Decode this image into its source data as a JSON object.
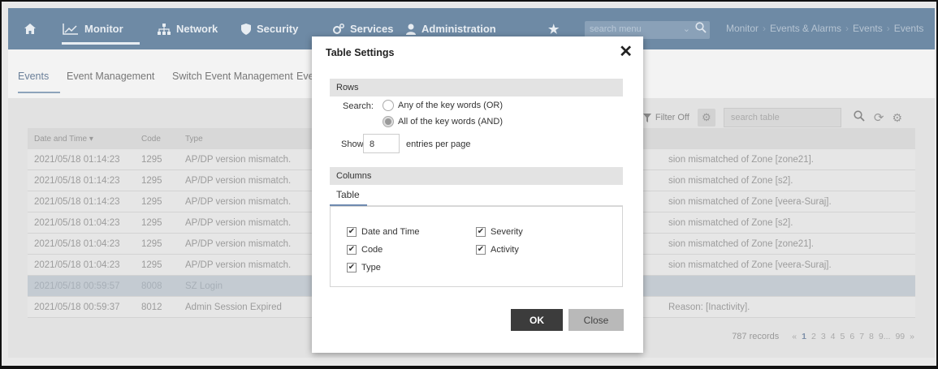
{
  "nav": {
    "monitor": "Monitor",
    "network": "Network",
    "security": "Security",
    "services": "Services",
    "administration": "Administration",
    "search_placeholder": "search menu"
  },
  "breadcrumb": [
    "Monitor",
    "Events & Alarms",
    "Events",
    "Events"
  ],
  "subtabs": [
    "Events",
    "Event Management",
    "Switch Event Management",
    "Eve"
  ],
  "toolbar": {
    "filter_label": "Filter Off",
    "search_placeholder": "search table"
  },
  "table": {
    "headers": {
      "datetime": "Date and Time",
      "code": "Code",
      "type": "Type"
    },
    "rows": [
      {
        "datetime": "2021/05/18 01:14:23",
        "code": "1295",
        "type": "AP/DP version mismatch.",
        "activity": "sion mismatched of Zone [zone21]."
      },
      {
        "datetime": "2021/05/18 01:14:23",
        "code": "1295",
        "type": "AP/DP version mismatch.",
        "activity": "sion mismatched of Zone [s2]."
      },
      {
        "datetime": "2021/05/18 01:14:23",
        "code": "1295",
        "type": "AP/DP version mismatch.",
        "activity": "sion mismatched of Zone [veera-Suraj]."
      },
      {
        "datetime": "2021/05/18 01:04:23",
        "code": "1295",
        "type": "AP/DP version mismatch.",
        "activity": "sion mismatched of Zone [s2]."
      },
      {
        "datetime": "2021/05/18 01:04:23",
        "code": "1295",
        "type": "AP/DP version mismatch.",
        "activity": "sion mismatched of Zone [zone21]."
      },
      {
        "datetime": "2021/05/18 01:04:23",
        "code": "1295",
        "type": "AP/DP version mismatch.",
        "activity": "sion mismatched of Zone [veera-Suraj]."
      },
      {
        "datetime": "2021/05/18 00:59:57",
        "code": "8008",
        "type": "SZ Login",
        "activity": ""
      },
      {
        "datetime": "2021/05/18 00:59:37",
        "code": "8012",
        "type": "Admin Session Expired",
        "activity": "Reason: [Inactivity]."
      }
    ]
  },
  "pager": {
    "records": "787 records",
    "prev": "«",
    "pages": [
      "1",
      "2",
      "3",
      "4",
      "5",
      "6",
      "7",
      "8",
      "9...",
      "99"
    ],
    "next": "»"
  },
  "modal": {
    "title": "Table Settings",
    "rows_section": "Rows",
    "search_label": "Search:",
    "opt_or": "Any of the key words (OR)",
    "opt_and": "All of the key words (AND)",
    "show_label": "Show",
    "show_value": "8",
    "entries_label": "entries per page",
    "columns_section": "Columns",
    "table_tab": "Table",
    "cols": {
      "datetime": "Date and Time",
      "code": "Code",
      "type": "Type",
      "severity": "Severity",
      "activity": "Activity"
    },
    "ok": "OK",
    "close": "Close"
  }
}
